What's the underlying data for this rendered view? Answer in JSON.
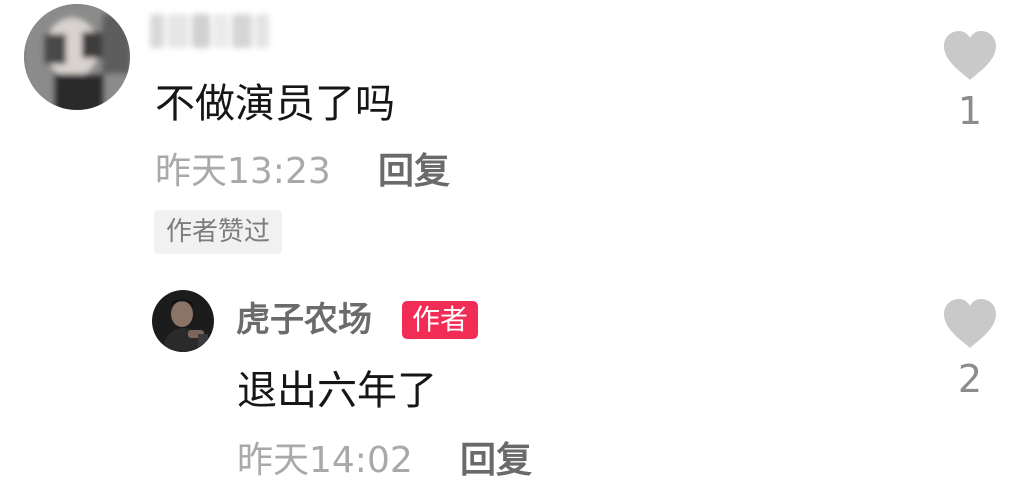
{
  "comment": {
    "text": "不做演员了吗",
    "time": "昨天13:23",
    "reply_label": "回复",
    "liked_tag": "作者赞过",
    "like_count": "1"
  },
  "reply": {
    "username": "虎子农场",
    "author_badge": "作者",
    "text": "退出六年了",
    "time": "昨天14:02",
    "reply_label": "回复",
    "like_count": "2"
  },
  "colors": {
    "badge_bg": "#f12d55",
    "heart": "#c9c9c9",
    "time_text": "#a9a9a9"
  }
}
